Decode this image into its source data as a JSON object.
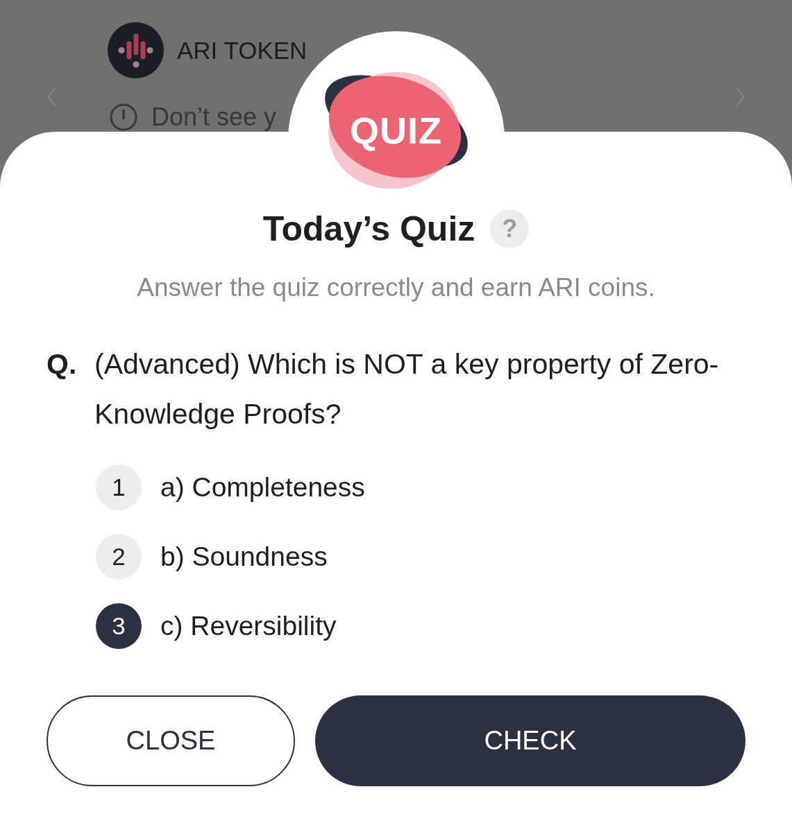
{
  "background": {
    "token_name": "ARI TOKEN",
    "notice": "Don’t see y"
  },
  "quiz": {
    "badge": "QUIZ",
    "title": "Today’s Quiz",
    "help": "?",
    "subtitle": "Answer the quiz correctly and earn ARI coins.",
    "question": {
      "prefix": "Q.",
      "text": "(Advanced) Which is NOT a key property of Zero-Knowledge Proofs?"
    },
    "options": [
      {
        "number": "1",
        "label": "a) Completeness",
        "selected": false
      },
      {
        "number": "2",
        "label": "b) Soundness",
        "selected": false
      },
      {
        "number": "3",
        "label": "c) Reversibility",
        "selected": true
      }
    ],
    "buttons": [
      {
        "label": "CLOSE",
        "kind": "outline"
      },
      {
        "label": "CHECK",
        "kind": "filled"
      }
    ]
  }
}
